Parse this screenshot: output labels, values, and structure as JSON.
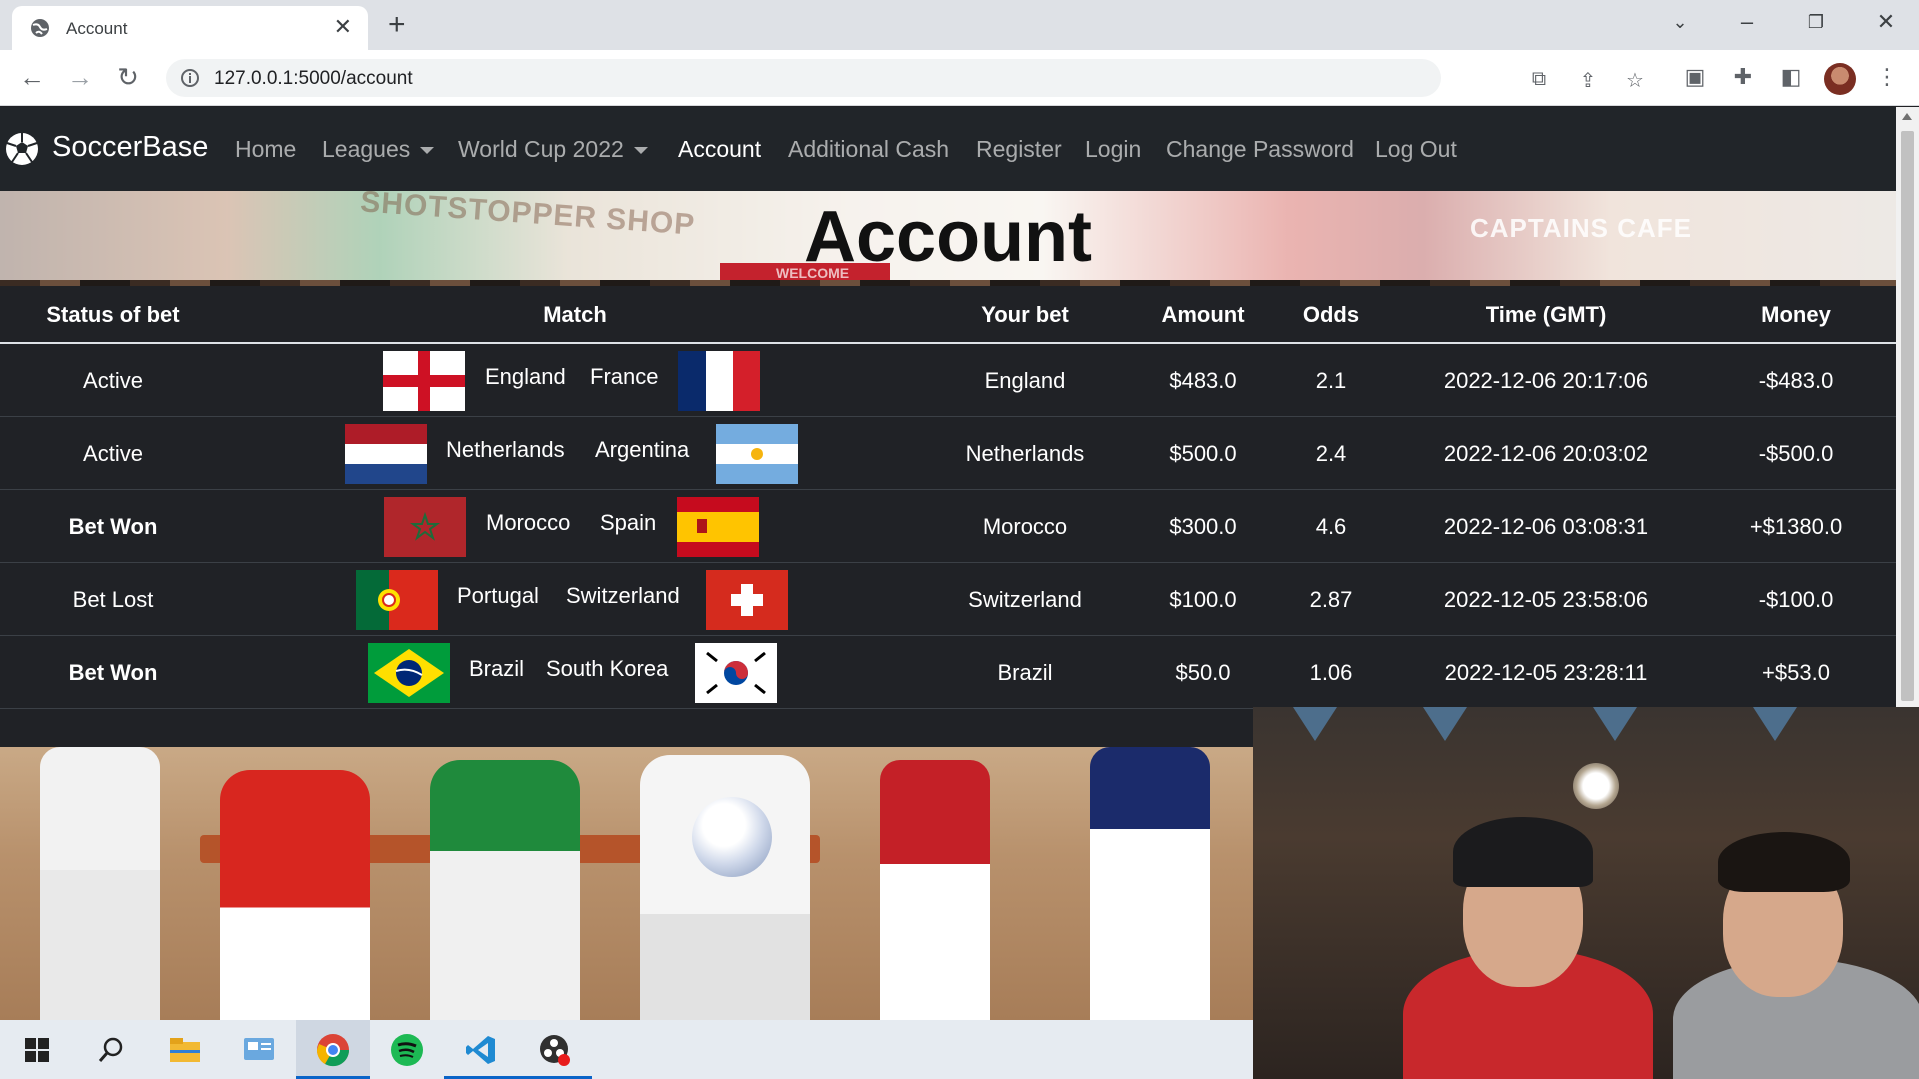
{
  "browser": {
    "tab_title": "Account",
    "url": "127.0.0.1:5000/account"
  },
  "site": {
    "brand": "SoccerBase",
    "nav": [
      {
        "label": "Home",
        "dropdown": false
      },
      {
        "label": "Leagues",
        "dropdown": true
      },
      {
        "label": "World Cup 2022",
        "dropdown": true
      },
      {
        "label": "Account",
        "dropdown": false
      },
      {
        "label": "Additional Cash",
        "dropdown": false
      },
      {
        "label": "Register",
        "dropdown": false
      },
      {
        "label": "Login",
        "dropdown": false
      },
      {
        "label": "Change Password",
        "dropdown": false
      },
      {
        "label": "Log Out",
        "dropdown": false
      }
    ]
  },
  "hero": {
    "title": "Account",
    "sign_shop": "SHOTSTOPPER SHOP",
    "sign_cafe": "CAPTAINS CAFE",
    "sign_welcome": "WELCOME"
  },
  "table": {
    "headers": [
      "Status of bet",
      "Match",
      "Your bet",
      "Amount",
      "Odds",
      "Time (GMT)",
      "Money"
    ],
    "rows": [
      {
        "status": "Active",
        "status_bold": false,
        "home": "England",
        "away": "France",
        "home_flag": "flag-england",
        "away_flag": "flag-france",
        "bet": "England",
        "amount": "$483.0",
        "odds": "2.1",
        "time": "2022-12-06 20:17:06",
        "money": "-$483.0"
      },
      {
        "status": "Active",
        "status_bold": false,
        "home": "Netherlands",
        "away": "Argentina",
        "home_flag": "flag-netherlands",
        "away_flag": "flag-argentina",
        "bet": "Netherlands",
        "amount": "$500.0",
        "odds": "2.4",
        "time": "2022-12-06 20:03:02",
        "money": "-$500.0"
      },
      {
        "status": "Bet Won",
        "status_bold": true,
        "home": "Morocco",
        "away": "Spain",
        "home_flag": "flag-morocco",
        "away_flag": "flag-spain",
        "bet": "Morocco",
        "amount": "$300.0",
        "odds": "4.6",
        "time": "2022-12-06 03:08:31",
        "money": "+$1380.0"
      },
      {
        "status": "Bet Lost",
        "status_bold": false,
        "home": "Portugal",
        "away": "Switzerland",
        "home_flag": "flag-portugal",
        "away_flag": "flag-switzerland",
        "bet": "Switzerland",
        "amount": "$100.0",
        "odds": "2.87",
        "time": "2022-12-05 23:58:06",
        "money": "-$100.0"
      },
      {
        "status": "Bet Won",
        "status_bold": true,
        "home": "Brazil",
        "away": "South Korea",
        "home_flag": "flag-brazil",
        "away_flag": "flag-south-korea",
        "bet": "Brazil",
        "amount": "$50.0",
        "odds": "1.06",
        "time": "2022-12-05 23:28:11",
        "money": "+$53.0"
      }
    ]
  },
  "taskbar": {
    "apps": [
      "windows-start-icon",
      "search-icon",
      "file-explorer-icon",
      "control-panel-icon",
      "chrome-icon",
      "spotify-icon",
      "vscode-icon",
      "obs-icon"
    ]
  },
  "colors": {
    "navbar_bg": "#212529",
    "table_bg": "#202226",
    "nav_link": "rgba(255,255,255,0.62)"
  }
}
